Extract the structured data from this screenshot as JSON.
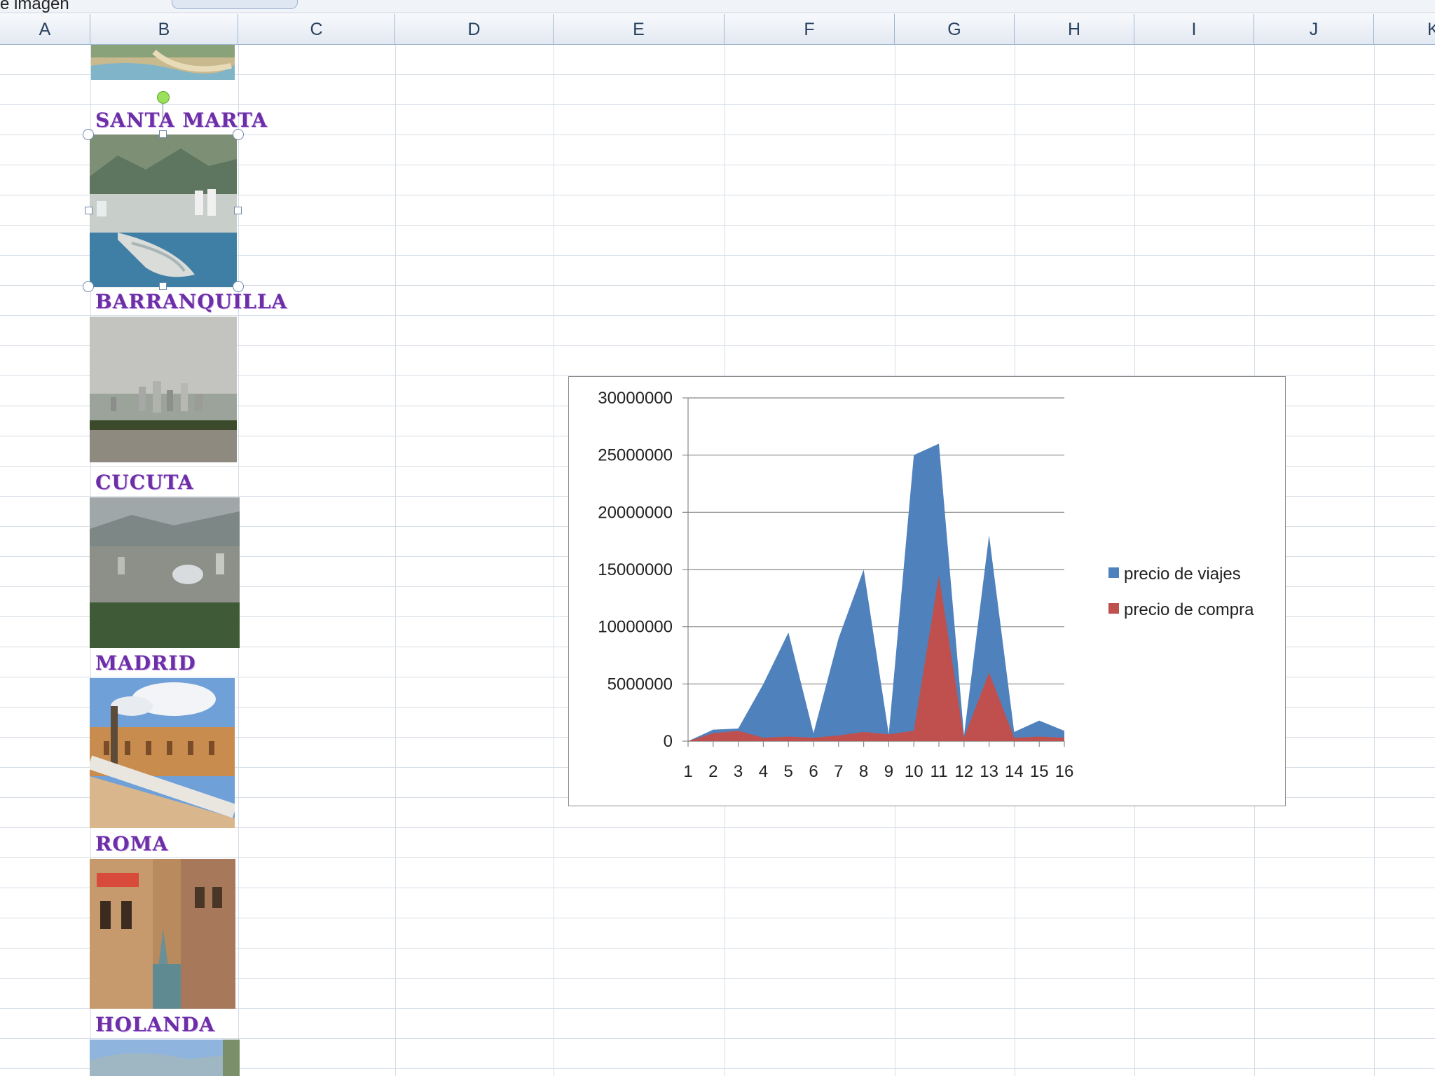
{
  "name_box": {
    "text": "e imagen"
  },
  "columns": [
    "A",
    "B",
    "C",
    "D",
    "E",
    "F",
    "G",
    "H",
    "I",
    "J",
    "K"
  ],
  "cities": [
    {
      "label": "SANTA MARTA"
    },
    {
      "label": "BARRANQUILLA"
    },
    {
      "label": "CUCUTA"
    },
    {
      "label": "MADRID"
    },
    {
      "label": "ROMA"
    },
    {
      "label": "HOLANDA"
    }
  ],
  "colors": {
    "series1": "#4f81bd",
    "series2": "#c0504d",
    "city_label": "#6d2fa8"
  },
  "chart_data": {
    "type": "area",
    "x": [
      1,
      2,
      3,
      4,
      5,
      6,
      7,
      8,
      9,
      10,
      11,
      12,
      13,
      14,
      15,
      16
    ],
    "ylim": [
      0,
      30000000
    ],
    "yticks": [
      0,
      5000000,
      10000000,
      15000000,
      20000000,
      25000000,
      30000000
    ],
    "ytick_labels": [
      "0",
      "5000000",
      "10000000",
      "15000000",
      "20000000",
      "25000000",
      "30000000"
    ],
    "legend_position": "right",
    "grid": true,
    "series": [
      {
        "name": "precio de viajes",
        "color": "#4f81bd",
        "values": [
          0,
          1000000,
          1100000,
          5000000,
          9500000,
          700000,
          9000000,
          15000000,
          600000,
          25000000,
          26000000,
          500000,
          18000000,
          800000,
          1800000,
          900000
        ]
      },
      {
        "name": "precio de compra",
        "color": "#c0504d",
        "values": [
          0,
          700000,
          900000,
          300000,
          400000,
          300000,
          500000,
          800000,
          600000,
          900000,
          14500000,
          300000,
          6000000,
          300000,
          400000,
          300000
        ]
      }
    ]
  }
}
